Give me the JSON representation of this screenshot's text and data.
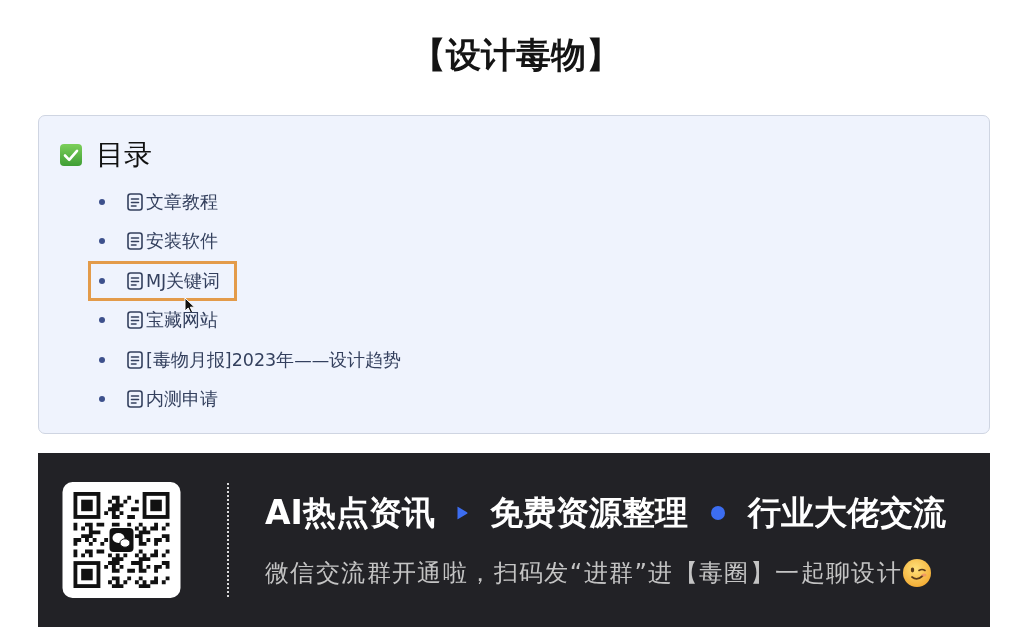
{
  "title": "【设计毒物】",
  "toc": {
    "heading": "目录",
    "items": [
      {
        "label": "文章教程",
        "highlighted": false
      },
      {
        "label": "安装软件",
        "highlighted": false
      },
      {
        "label": "MJ关键词",
        "highlighted": true
      },
      {
        "label": "宝藏网站",
        "highlighted": false
      },
      {
        "label": "[毒物月报]2023年——设计趋势",
        "highlighted": false
      },
      {
        "label": "内测申请",
        "highlighted": false
      }
    ]
  },
  "banner": {
    "headline": [
      {
        "kind": "text",
        "text": "AI热点资讯"
      },
      {
        "kind": "triangle"
      },
      {
        "kind": "text",
        "text": "免费资源整理"
      },
      {
        "kind": "dot"
      },
      {
        "kind": "text",
        "text": "行业大佬交流"
      }
    ],
    "subtitle": "微信交流群开通啦，扫码发“进群”进【毒圈】一起聊设计"
  }
}
